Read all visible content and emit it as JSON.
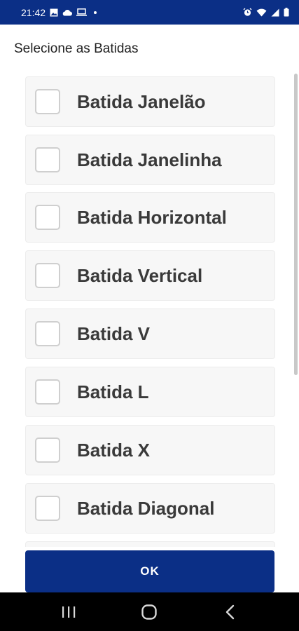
{
  "status_bar": {
    "time": "21:42",
    "left_icons": [
      "image-icon",
      "cloud-icon",
      "laptop-icon",
      "dot-icon"
    ],
    "right_icons": [
      "alarm-icon",
      "wifi-icon",
      "signal-icon",
      "battery-icon"
    ],
    "background": "#0b2f86"
  },
  "header": {
    "title": "Selecione as Batidas"
  },
  "options": [
    {
      "label": "Batida Janelão",
      "checked": false
    },
    {
      "label": "Batida Janelinha",
      "checked": false
    },
    {
      "label": "Batida Horizontal",
      "checked": false
    },
    {
      "label": "Batida Vertical",
      "checked": false
    },
    {
      "label": "Batida V",
      "checked": false
    },
    {
      "label": "Batida L",
      "checked": false
    },
    {
      "label": "Batida X",
      "checked": false
    },
    {
      "label": "Batida Diagonal",
      "checked": false
    },
    {
      "label": "",
      "checked": false
    }
  ],
  "ok_button": {
    "label": "OK",
    "color": "#0b2f86"
  },
  "nav_bar": {
    "icons": [
      "recent-apps-icon",
      "home-icon",
      "back-icon"
    ]
  }
}
